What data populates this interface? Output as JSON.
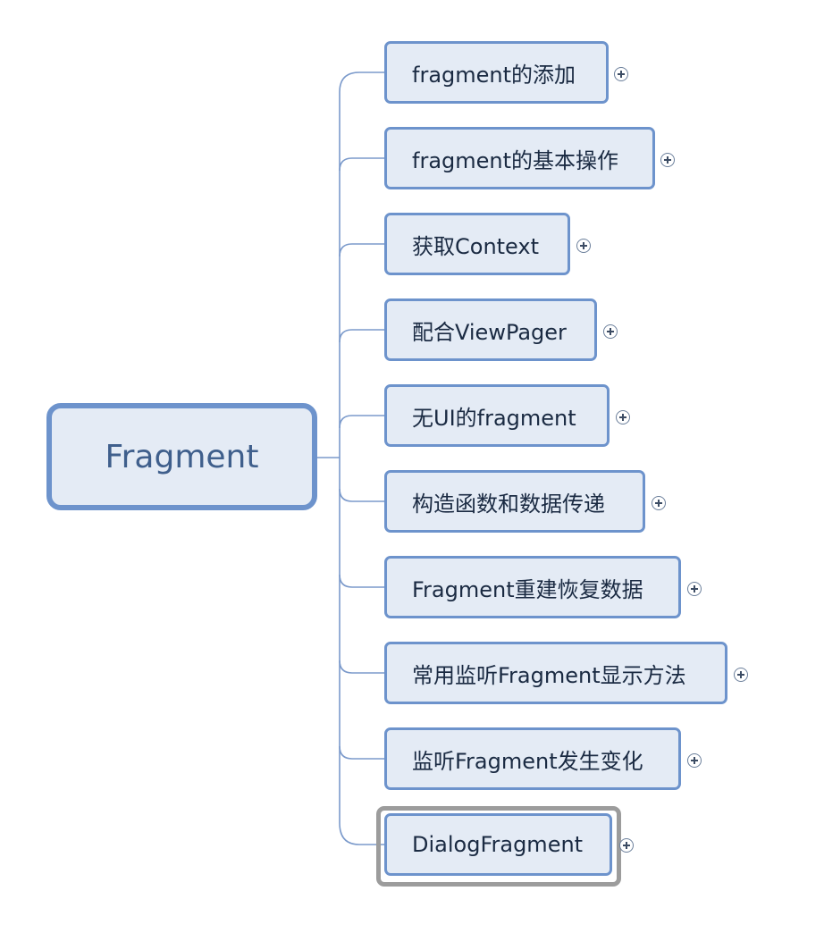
{
  "root": {
    "label": "Fragment"
  },
  "children": [
    {
      "label": "fragment的添加"
    },
    {
      "label": "fragment的基本操作"
    },
    {
      "label": "获取Context"
    },
    {
      "label": "配合ViewPager"
    },
    {
      "label": "无UI的fragment"
    },
    {
      "label": "构造函数和数据传递"
    },
    {
      "label": "Fragment重建恢复数据"
    },
    {
      "label": "常用监听Fragment显示方法"
    },
    {
      "label": "监听Fragment发生变化"
    },
    {
      "label": "DialogFragment",
      "selected": true
    }
  ],
  "colors": {
    "node_border": "#6d93cc",
    "node_fill": "#e4ebf5",
    "connector": "#7b9acb",
    "selection": "#9c9c9c"
  },
  "icons": {
    "expand": "plus-circle-icon"
  }
}
